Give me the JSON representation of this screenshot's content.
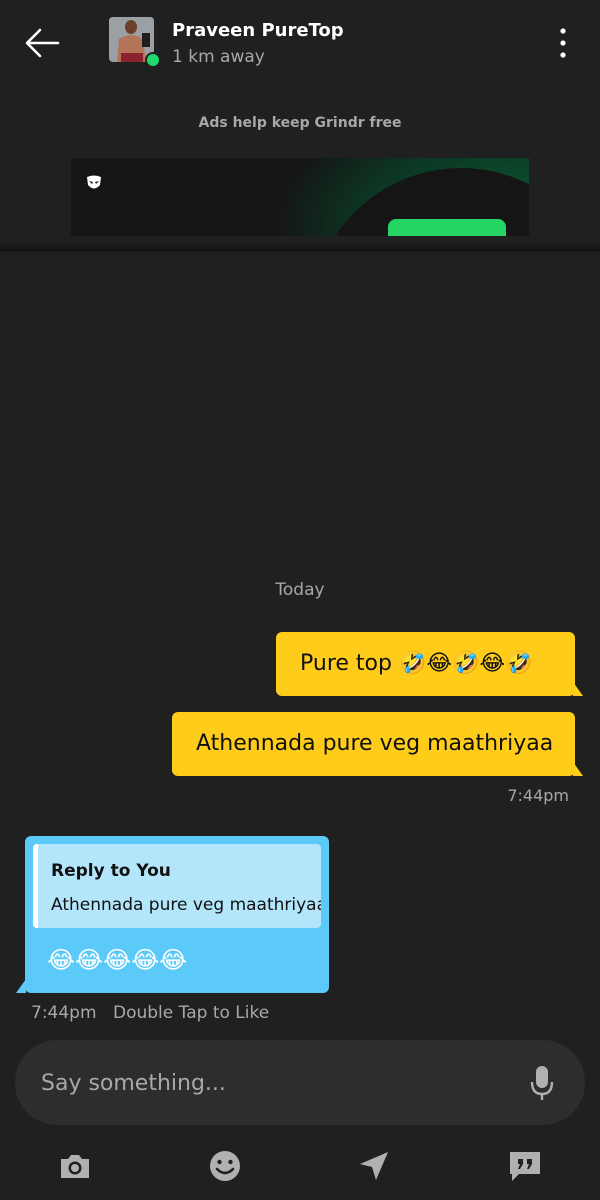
{
  "header": {
    "profile_name": "Praveen PureTop",
    "distance": "1 km away",
    "online": true
  },
  "ad": {
    "caption": "Ads help keep Grindr free"
  },
  "chat": {
    "date_separator": "Today",
    "outgoing": [
      {
        "text": "Pure top 🤣😂🤣😂🤣"
      },
      {
        "text": "Athennada pure veg maathriyaa"
      }
    ],
    "outgoing_time": "7:44pm",
    "incoming": {
      "reply_title": "Reply to You",
      "reply_quote": "Athennada pure veg maathriyaa",
      "text": "😂😂😂😂😂",
      "time": "7:44pm",
      "like_hint": "Double Tap to Like"
    }
  },
  "composer": {
    "placeholder": "Say something..."
  },
  "colors": {
    "background": "#202020",
    "outgoing_bubble": "#ffcc19",
    "incoming_bubble": "#5ccaf8",
    "reply_box": "#b3e6fb",
    "online_dot": "#1fd86e",
    "ad_cta": "#26d466"
  },
  "toolbar": {
    "icons": [
      "camera-icon",
      "emoji-icon",
      "location-icon",
      "saved-phrases-icon"
    ]
  }
}
